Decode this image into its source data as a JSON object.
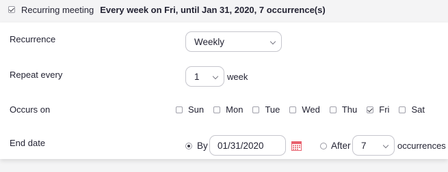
{
  "recurring": {
    "checked": true,
    "label": "Recurring meeting",
    "summary": "Every week on Fri, until Jan 31, 2020, 7 occurrence(s)"
  },
  "recurrence": {
    "label": "Recurrence",
    "value": "Weekly"
  },
  "repeat_every": {
    "label": "Repeat every",
    "value": "1",
    "unit": "week"
  },
  "occurs_on": {
    "label": "Occurs on",
    "days": [
      {
        "label": "Sun",
        "checked": false
      },
      {
        "label": "Mon",
        "checked": false
      },
      {
        "label": "Tue",
        "checked": false
      },
      {
        "label": "Wed",
        "checked": false
      },
      {
        "label": "Thu",
        "checked": false
      },
      {
        "label": "Fri",
        "checked": true
      },
      {
        "label": "Sat",
        "checked": false
      }
    ]
  },
  "end_date": {
    "label": "End date",
    "by_label": "By",
    "by_selected": true,
    "date_value": "01/31/2020",
    "after_label": "After",
    "occurrences_value": "7",
    "occurrences_label": "occurrences"
  },
  "colors": {
    "calendar_icon": "#e8606d",
    "border": "#c6c6cd",
    "text": "#232333"
  }
}
